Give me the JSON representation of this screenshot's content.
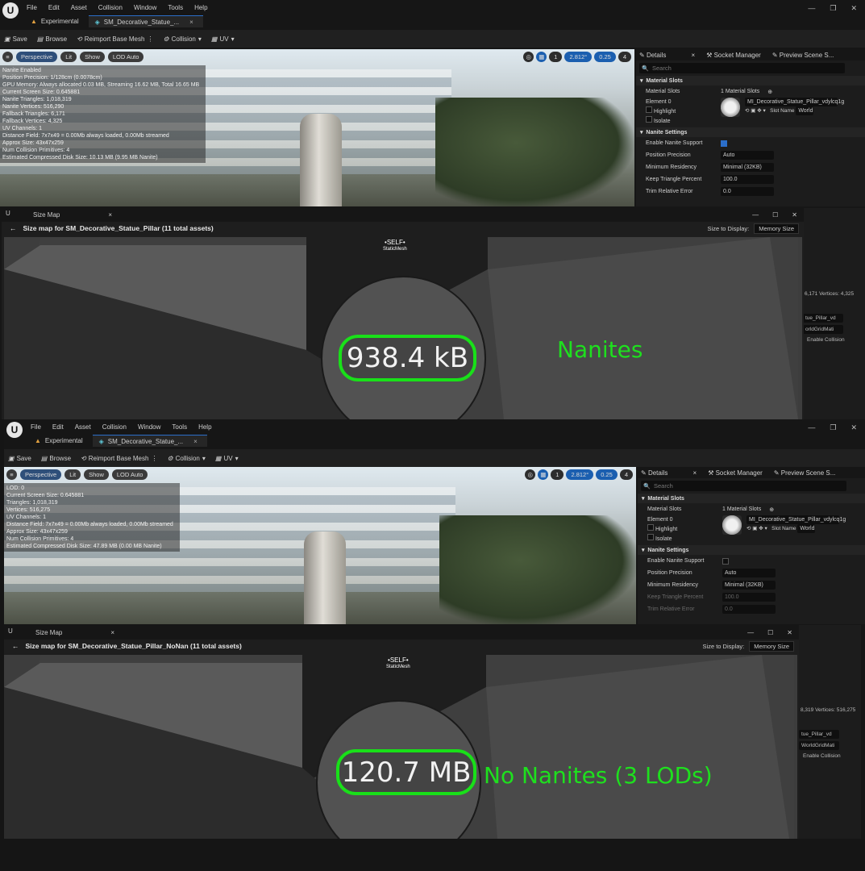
{
  "editors": [
    {
      "menu": [
        "File",
        "Edit",
        "Asset",
        "Collision",
        "Window",
        "Tools",
        "Help"
      ],
      "tabs": [
        "Experimental",
        "SM_Decorative_Statue_..."
      ],
      "toolbar": {
        "save": "Save",
        "browse": "Browse",
        "reimport": "Reimport Base Mesh",
        "collision": "Collision",
        "uv": "UV"
      },
      "viewport": {
        "perspective": "Perspective",
        "lit": "Lit",
        "show": "Show",
        "lod": "LOD Auto",
        "grid": "1",
        "angle": "2.812°",
        "scale": "0.25",
        "cam": "4",
        "stats": [
          "Nanite Enabled",
          "Position Precision: 1/128cm (0.0078cm)",
          "GPU Memory: Always allocated 0.03 MB, Streaming 16.62 MB, Total 16.65 MB",
          "Current Screen Size: 0.645881",
          "Nanite Triangles: 1,018,319",
          "Nanite Vertices: 516,290",
          "Fallback Triangles: 6,171",
          "Fallback Vertices: 4,325",
          "UV Channels: 1",
          "Distance Field: 7x7x49 = 0.00Mb always loaded, 0.00Mb streamed",
          "Approx Size: 43x47x259",
          "Num Collision Primitives: 4",
          "Estimated Compressed Disk Size: 10.13 MB (9.95 MB Nanite)"
        ]
      },
      "details": {
        "tabs": [
          "Details",
          "Socket Manager",
          "Preview Scene S..."
        ],
        "search": "Search",
        "material_slots_section": "Material Slots",
        "material_slots_label": "Material Slots",
        "material_slots_value": "1 Material Slots",
        "element": "Element 0",
        "highlight": "Highlight",
        "isolate": "Isolate",
        "material": "MI_Decorative_Statue_Pillar_vdylcq1g",
        "slot_name": "Slot Name",
        "slot_value": "World",
        "nanite_section": "Nanite Settings",
        "enable": "Enable Nanite Support",
        "precision": "Position Precision",
        "precision_v": "Auto",
        "residency": "Minimum Residency",
        "residency_v": "Minimal (32KB)",
        "keep": "Keep Triangle Percent",
        "keep_v": "100.0",
        "trim": "Trim Relative Error",
        "trim_v": "0.0"
      },
      "right_strip": [
        "6,171   Vertices: 4,325",
        "tue_Pillar_vd",
        "orldGridMati",
        "Enable Collision"
      ],
      "sizemap": {
        "tab": "Size Map",
        "header": "Size map for SM_Decorative_Statue_Pillar  (11 total assets)",
        "display_label": "Size to Display:",
        "display_value": "Memory Size",
        "self": "•SELF•",
        "self_sub": "StaticMesh",
        "size": "938.4 kB",
        "annotation": "Nanites"
      }
    },
    {
      "menu": [
        "File",
        "Edit",
        "Asset",
        "Collision",
        "Window",
        "Tools",
        "Help"
      ],
      "tabs": [
        "Experimental",
        "SM_Decorative_Statue_..."
      ],
      "toolbar": {
        "save": "Save",
        "browse": "Browse",
        "reimport": "Reimport Base Mesh",
        "collision": "Collision",
        "uv": "UV"
      },
      "viewport": {
        "perspective": "Perspective",
        "lit": "Lit",
        "show": "Show",
        "lod": "LOD Auto",
        "grid": "1",
        "angle": "2.812°",
        "scale": "0.25",
        "cam": "4",
        "stats": [
          "LOD:  0",
          "Current Screen Size:  0.645881",
          "Triangles:  1,018,319",
          "Vertices:  516,275",
          "UV Channels:  1",
          "Distance Field: 7x7x49 = 0.00Mb always loaded, 0.00Mb streamed",
          "Approx Size: 43x47x259",
          "Num Collision Primitives: 4",
          "Estimated Compressed Disk Size: 47.89 MB (0.00 MB Nanite)"
        ]
      },
      "details": {
        "tabs": [
          "Details",
          "Socket Manager",
          "Preview Scene S..."
        ],
        "search": "Search",
        "material_slots_section": "Material Slots",
        "material_slots_label": "Material Slots",
        "material_slots_value": "1 Material Slots",
        "element": "Element 0",
        "highlight": "Highlight",
        "isolate": "Isolate",
        "material": "MI_Decorative_Statue_Pillar_vdylcq1g",
        "slot_name": "Slot Name",
        "slot_value": "World",
        "nanite_section": "Nanite Settings",
        "enable": "Enable Nanite Support",
        "precision": "Position Precision",
        "precision_v": "Auto",
        "residency": "Minimum Residency",
        "residency_v": "Minimal (32KB)",
        "keep": "Keep Triangle Percent",
        "keep_v": "100.0",
        "trim": "Trim Relative Error",
        "trim_v": "0.0"
      },
      "right_strip": [
        "8,319   Vertices: 516,275",
        "tue_Pillar_vd",
        "WorldGridMati",
        "Enable Collision"
      ],
      "sizemap": {
        "tab": "Size Map",
        "header": "Size map for SM_Decorative_Statue_Pillar_NoNan  (11 total assets)",
        "display_label": "Size to Display:",
        "display_value": "Memory Size",
        "self": "•SELF•",
        "self_sub": "StaticMesh",
        "size": "120.7 MB",
        "annotation": "No Nanites (3 LODs)"
      }
    }
  ]
}
